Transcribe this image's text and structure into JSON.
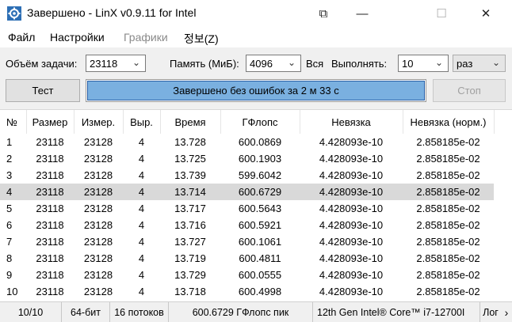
{
  "window": {
    "title": "Завершено - LinX v0.9.11 for Intel",
    "pin_glyph": "⧉",
    "minimize_glyph": "—",
    "maximize_glyph": "☐",
    "close_glyph": "✕"
  },
  "menu": {
    "items": [
      {
        "label": "Файл"
      },
      {
        "label": "Настройки"
      },
      {
        "label": "Графики"
      },
      {
        "label": "정보(Z)"
      }
    ]
  },
  "toolbar": {
    "problem_size_label": "Объём задачи:",
    "problem_size_value": "23118",
    "memory_label": "Память (МиБ):",
    "memory_value": "4096",
    "all_label": "Вся",
    "run_label": "Выполнять:",
    "run_value": "10",
    "run_unit": "раз",
    "test_button": "Тест",
    "stop_button": "Стоп",
    "progress_text": "Завершено без ошибок за 2 м 33 с",
    "progress_fraction": 1.0
  },
  "table": {
    "columns": [
      "№",
      "Размер",
      "Измер.",
      "Выр.",
      "Время",
      "ГФлопс",
      "Невязка",
      "Невязка (норм.)"
    ],
    "selected_row": 4,
    "rows": [
      [
        "1",
        "23118",
        "23128",
        "4",
        "13.728",
        "600.0869",
        "4.428093e-10",
        "2.858185e-02"
      ],
      [
        "2",
        "23118",
        "23128",
        "4",
        "13.725",
        "600.1903",
        "4.428093e-10",
        "2.858185e-02"
      ],
      [
        "3",
        "23118",
        "23128",
        "4",
        "13.739",
        "599.6042",
        "4.428093e-10",
        "2.858185e-02"
      ],
      [
        "4",
        "23118",
        "23128",
        "4",
        "13.714",
        "600.6729",
        "4.428093e-10",
        "2.858185e-02"
      ],
      [
        "5",
        "23118",
        "23128",
        "4",
        "13.717",
        "600.5643",
        "4.428093e-10",
        "2.858185e-02"
      ],
      [
        "6",
        "23118",
        "23128",
        "4",
        "13.716",
        "600.5921",
        "4.428093e-10",
        "2.858185e-02"
      ],
      [
        "7",
        "23118",
        "23128",
        "4",
        "13.727",
        "600.1061",
        "4.428093e-10",
        "2.858185e-02"
      ],
      [
        "8",
        "23118",
        "23128",
        "4",
        "13.719",
        "600.4811",
        "4.428093e-10",
        "2.858185e-02"
      ],
      [
        "9",
        "23118",
        "23128",
        "4",
        "13.729",
        "600.0555",
        "4.428093e-10",
        "2.858185e-02"
      ],
      [
        "10",
        "23118",
        "23128",
        "4",
        "13.718",
        "600.4998",
        "4.428093e-10",
        "2.858185e-02"
      ]
    ]
  },
  "status": {
    "runs": "10/10",
    "bits": "64-бит",
    "threads": "16 потоков",
    "peak": "600.6729 ГФлопс пик",
    "cpu": "12th Gen Intel® Core™ i7-12700I",
    "log": "Лог",
    "log_arrow": "›"
  },
  "colors": {
    "progress_fill": "#7ab0e0",
    "progress_border": "#2a60a6",
    "selected_row": "#d9d9d9"
  }
}
